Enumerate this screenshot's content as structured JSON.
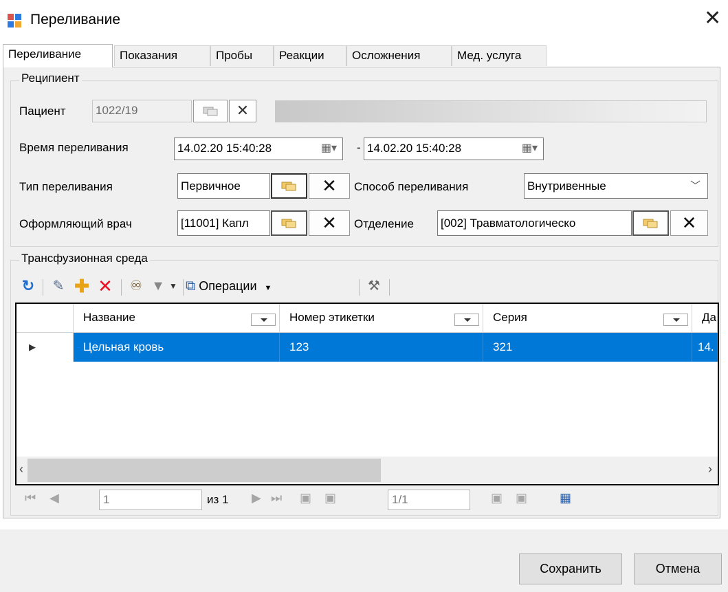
{
  "window": {
    "title": "Переливание",
    "close_glyph": "✕"
  },
  "tabs": [
    "Переливание",
    "Показания",
    "Пробы",
    "Реакции",
    "Осложнения",
    "Мед. услуга"
  ],
  "recipient": {
    "legend": "Реципиент",
    "patient_label": "Пациент",
    "patient_value": "1022/19",
    "time_label": "Время переливания",
    "time_from": "14.02.20 15:40:28",
    "time_dash": "-",
    "time_to": "14.02.20 15:40:28",
    "type_label": "Тип переливания",
    "type_value": "Первичное",
    "method_label": "Способ переливания",
    "method_value": "Внутривенные",
    "doctor_label": "Оформляющий врач",
    "doctor_value": "[11001] Капл",
    "department_label": "Отделение",
    "department_value": "[002] Травматологическо"
  },
  "transfusion": {
    "legend": "Трансфузионная среда",
    "operations_label": "Операции",
    "columns": [
      "Название",
      "Номер этикетки",
      "Серия",
      "Да"
    ],
    "rows": [
      {
        "name": "Цельная кровь",
        "label_no": "123",
        "series": "321",
        "date": "14."
      }
    ]
  },
  "pager": {
    "page_value": "1",
    "of_text": "из 1",
    "counter": "1/1"
  },
  "footer": {
    "save_label": "Сохранить",
    "cancel_label": "Отмена"
  },
  "icons": {
    "refresh": "refresh-icon",
    "edit": "edit-icon",
    "add": "add-icon",
    "delete": "delete-icon",
    "find": "binoculars-icon",
    "filter": "filter-icon",
    "operations": "operations-icon",
    "tools": "tools-icon"
  },
  "colors": {
    "selection": "#0078d7",
    "add_icon": "#e8a317",
    "delete_icon": "#e81123",
    "refresh_icon": "#1e6fd0"
  }
}
